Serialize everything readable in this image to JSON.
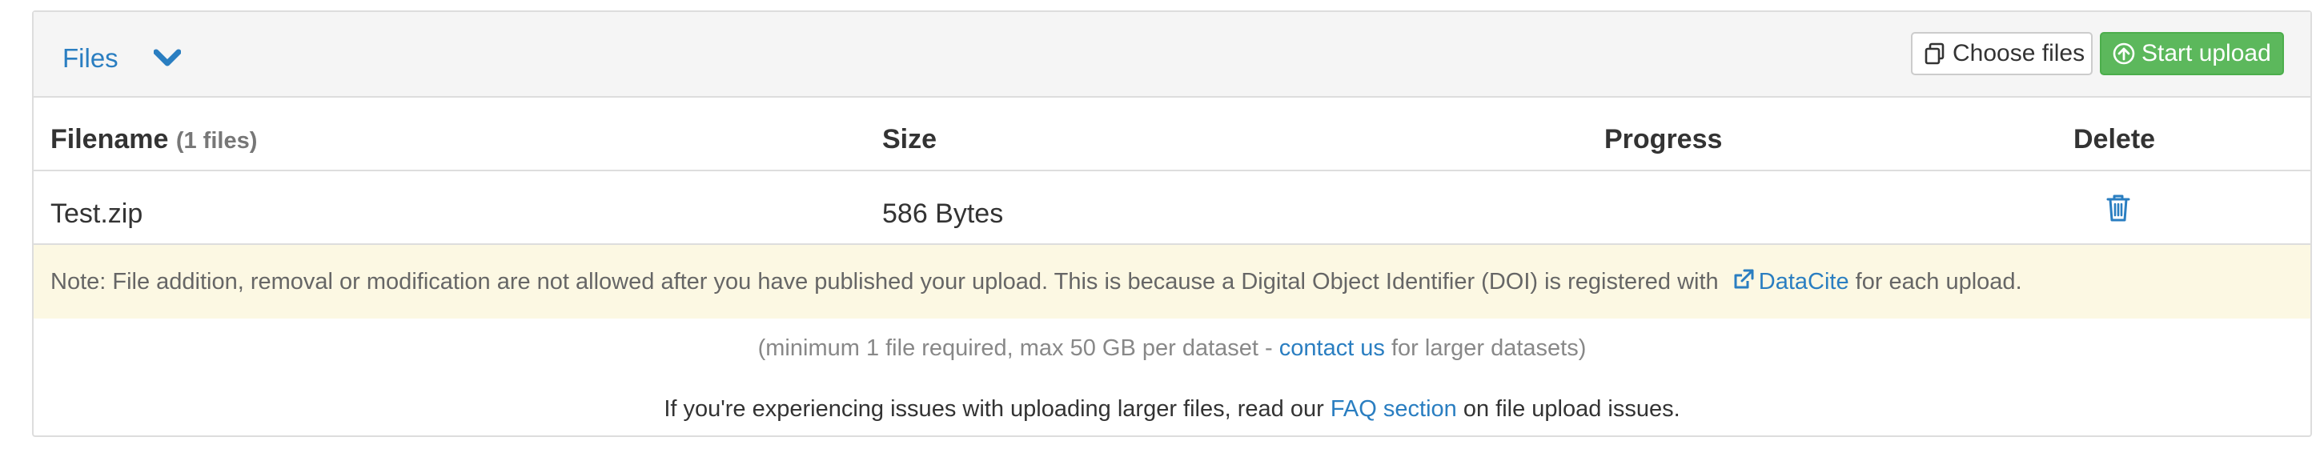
{
  "header": {
    "title": "Files",
    "choose_files_label": "Choose files",
    "start_upload_label": "Start upload"
  },
  "table": {
    "columns": {
      "filename": "Filename",
      "filename_count": "(1 files)",
      "size": "Size",
      "progress": "Progress",
      "delete": "Delete"
    },
    "rows": [
      {
        "filename": "Test.zip",
        "size": "586 Bytes"
      }
    ]
  },
  "note": {
    "text_before": "Note: File addition, removal or modification are not allowed after you have published your upload. This is because a Digital Object Identifier (DOI) is registered with ",
    "link": "DataCite",
    "text_after": " for each upload."
  },
  "info1": {
    "before": "(minimum 1 file required, max 50 GB per dataset - ",
    "link": "contact us",
    "after": " for larger datasets)"
  },
  "info2": {
    "before": "If you're experiencing issues with uploading larger files, read our ",
    "link": "FAQ section",
    "after": " on file upload issues."
  },
  "colors": {
    "link": "#2a7ec1",
    "success": "#5cb85c",
    "warning_bg": "#fcf8e3",
    "header_bg": "#f5f5f5"
  },
  "icons": {
    "toggle": "chevron-down-icon",
    "choose": "copy-icon",
    "upload": "arrow-circle-up-icon",
    "delete": "trash-icon",
    "external": "external-link-icon"
  }
}
